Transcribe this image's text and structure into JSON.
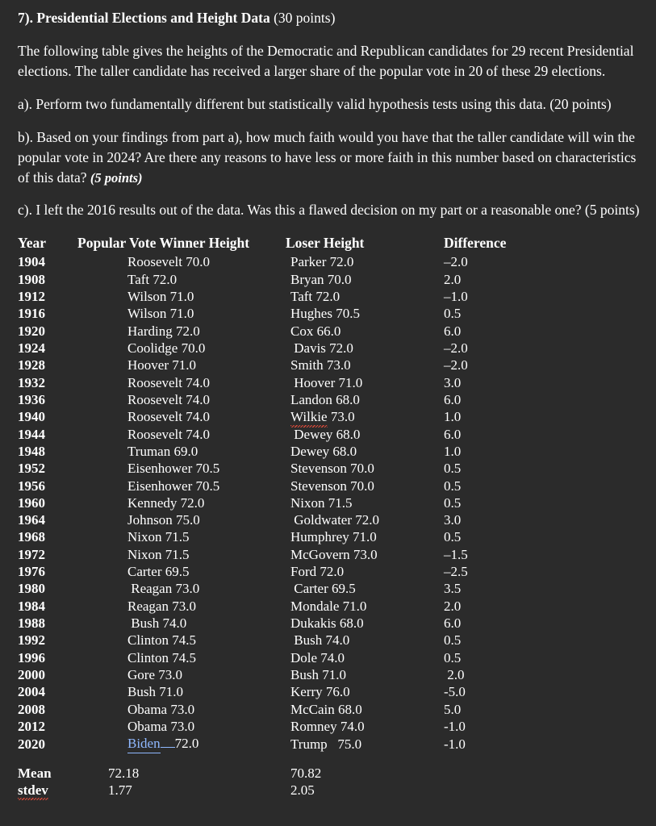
{
  "document": {
    "question_number": "7).",
    "question_title": "Presidential Elections and Height Data",
    "question_points": "(30 points)",
    "paragraphs": [
      "The following table gives the heights of the Democratic and Republican candidates for 29 recent Presidential elections.  The taller candidate has received a larger share of the popular vote in 20 of these 29 elections.",
      "a). Perform two fundamentally different but statistically valid hypothesis tests using this data. (20 points)",
      "b).  Based on your findings from part a), how much faith would you have that the taller candidate will win the popular vote in 2024?   Are there any reasons to have less or more faith in this number based on characteristics of this data?",
      "c).  I left the 2016 results out of the data.   Was this a flawed decision on my part or a reasonable one? (5 points)"
    ],
    "part_b_points": "(5 points)",
    "table": {
      "headers": {
        "year": "Year",
        "winner": "Popular Vote Winner Height",
        "loser": "Loser Height",
        "difference": "Difference"
      },
      "rows": [
        {
          "year": "1904",
          "winner": "Roosevelt 70.0",
          "loser": "Parker 72.0",
          "difference": "–2.0"
        },
        {
          "year": "1908",
          "winner": "Taft 72.0",
          "loser": "Bryan 70.0",
          "difference": "2.0"
        },
        {
          "year": "1912",
          "winner": "Wilson 71.0",
          "loser": "Taft 72.0",
          "difference": "–1.0"
        },
        {
          "year": "1916",
          "winner": "Wilson 71.0",
          "loser": "Hughes 70.5",
          "difference": "0.5"
        },
        {
          "year": "1920",
          "winner": "Harding 72.0",
          "loser": "Cox 66.0",
          "difference": "6.0"
        },
        {
          "year": "1924",
          "winner": "Coolidge 70.0",
          "loser": " Davis 72.0",
          "difference": "–2.0"
        },
        {
          "year": "1928",
          "winner": "Hoover 71.0",
          "loser": "Smith 73.0",
          "difference": "–2.0"
        },
        {
          "year": "1932",
          "winner": "Roosevelt 74.0",
          "loser": " Hoover 71.0",
          "difference": "3.0"
        },
        {
          "year": "1936",
          "winner": "Roosevelt 74.0",
          "loser": "Landon 68.0",
          "difference": "6.0"
        },
        {
          "year": "1940",
          "winner": "Roosevelt 74.0",
          "loser": "Wilkie 73.0",
          "difference": "1.0",
          "loser_misspelled": true
        },
        {
          "year": "1944",
          "winner": "Roosevelt 74.0",
          "loser": " Dewey 68.0",
          "difference": "6.0"
        },
        {
          "year": "1948",
          "winner": "Truman 69.0",
          "loser": "Dewey 68.0",
          "difference": "1.0"
        },
        {
          "year": "1952",
          "winner": "Eisenhower 70.5",
          "loser": "Stevenson 70.0",
          "difference": "0.5"
        },
        {
          "year": "1956",
          "winner": "Eisenhower 70.5",
          "loser": "Stevenson 70.0",
          "difference": "0.5"
        },
        {
          "year": "1960",
          "winner": "Kennedy 72.0",
          "loser": "Nixon 71.5",
          "difference": "0.5"
        },
        {
          "year": "1964",
          "winner": "Johnson 75.0",
          "loser": " Goldwater 72.0",
          "difference": "3.0"
        },
        {
          "year": "1968",
          "winner": "Nixon 71.5",
          "loser": "Humphrey 71.0",
          "difference": "0.5"
        },
        {
          "year": "1972",
          "winner": "Nixon 71.5",
          "loser": "McGovern 73.0",
          "difference": "–1.5"
        },
        {
          "year": "1976",
          "winner": "Carter 69.5",
          "loser": "Ford 72.0",
          "difference": "–2.5"
        },
        {
          "year": "1980",
          "winner": " Reagan 73.0",
          "loser": " Carter 69.5",
          "difference": "3.5"
        },
        {
          "year": "1984",
          "winner": "Reagan 73.0",
          "loser": "Mondale 71.0",
          "difference": "2.0"
        },
        {
          "year": "1988",
          "winner": " Bush 74.0",
          "loser": "Dukakis 68.0",
          "difference": "6.0"
        },
        {
          "year": "1992",
          "winner": "Clinton 74.5",
          "loser": " Bush 74.0",
          "difference": "0.5"
        },
        {
          "year": "1996",
          "winner": "Clinton 74.5",
          "loser": "Dole 74.0",
          "difference": "0.5"
        },
        {
          "year": "2000",
          "winner": "Gore 73.0",
          "loser": "Bush 71.0",
          "difference": " 2.0"
        },
        {
          "year": "2004",
          "winner": "Bush 71.0",
          "loser": "Kerry 76.0",
          "difference": "-5.0"
        },
        {
          "year": "2008",
          "winner": "Obama 73.0",
          "loser": "McCain 68.0",
          "difference": "5.0"
        },
        {
          "year": "2012",
          "winner": "Obama 73.0",
          "loser": "Romney 74.0",
          "difference": "-1.0"
        },
        {
          "year": "2020",
          "winner": "Biden   72.0",
          "loser": "Trump   75.0",
          "difference": "-1.0",
          "winner_edited": true
        }
      ],
      "summary": [
        {
          "label": "Mean",
          "winner": "72.18",
          "loser": "70.82"
        },
        {
          "label": "stdev",
          "winner": "1.77",
          "loser": "2.05",
          "label_misspelled": true
        }
      ]
    }
  },
  "colors": {
    "background": "#2b2b2b",
    "text": "#ffffff",
    "spellcheck_underline": "#d84a3a",
    "tracked_change": "#8fb8ff"
  }
}
